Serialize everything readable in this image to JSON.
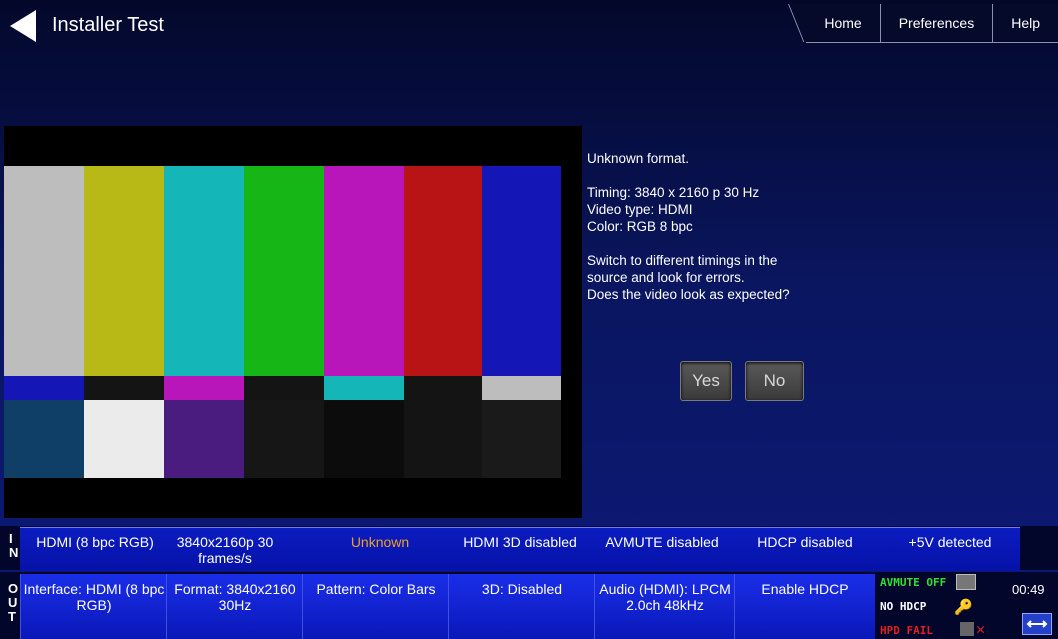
{
  "header": {
    "title": "Installer Test",
    "tabs": [
      "Home",
      "Preferences",
      "Help"
    ]
  },
  "info": {
    "status": "Unknown format.",
    "timing": "Timing: 3840 x 2160 p 30 Hz",
    "video_type": "Video type: HDMI",
    "color": "Color: RGB 8 bpc",
    "instructions": [
      "Switch to different timings in the",
      "source and look for errors.",
      "Does the video look as expected?"
    ],
    "yes_label": "Yes",
    "no_label": "No"
  },
  "in_status": {
    "label": "IN",
    "items": [
      "HDMI (8 bpc RGB)",
      "3840x2160p 30 frames/s",
      "Unknown",
      "HDMI 3D disabled",
      "AVMUTE disabled",
      "HDCP disabled",
      "+5V detected"
    ]
  },
  "out_status": {
    "label": "OUT",
    "buttons": [
      {
        "label": "Interface: HDMI (8 bpc RGB)"
      },
      {
        "label": "Format: 3840x2160 30Hz"
      },
      {
        "label": "Pattern: Color Bars"
      },
      {
        "label": "3D: Disabled"
      },
      {
        "label": "Audio (HDMI): LPCM 2.0ch 48kHz"
      },
      {
        "label": "Enable HDCP"
      }
    ],
    "indicators": {
      "avmute": "AVMUTE OFF",
      "hdcp": "NO HDCP",
      "hpd": "HPD FAIL"
    },
    "clock": "00:49"
  },
  "colors": {
    "unknown_text": "#f0a020",
    "avmute_text": "#30e030",
    "hpd_text": "#e02020",
    "key_icon": "#f0b000"
  },
  "test_pattern": "color-bars"
}
